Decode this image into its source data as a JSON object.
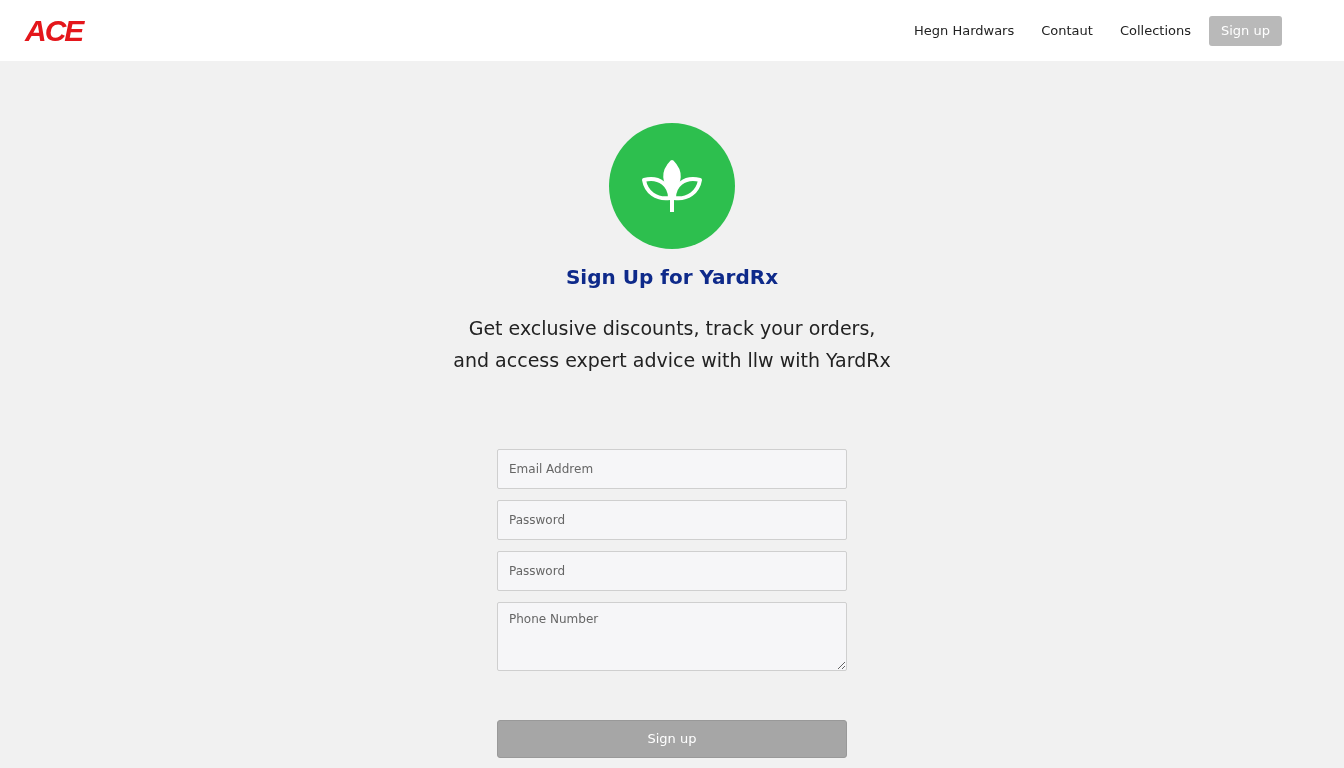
{
  "header": {
    "logo": "ACE",
    "nav": [
      {
        "label": "Hegn Hardwars",
        "kind": "link"
      },
      {
        "label": "Contaut",
        "kind": "link"
      },
      {
        "label": "Collections",
        "kind": "link"
      },
      {
        "label": "Sign up",
        "kind": "button"
      }
    ]
  },
  "hero": {
    "title": "Sign Up for YardRx",
    "lines": [
      "Get exclusive discounts, track your orders,",
      "and access expert advice with llw with YardRx"
    ]
  },
  "form": {
    "fields": [
      {
        "placeholder": "Email Addrem",
        "kind": "input"
      },
      {
        "placeholder": "Password",
        "kind": "input"
      },
      {
        "placeholder": "Password",
        "kind": "input"
      },
      {
        "placeholder": "Phone Number",
        "kind": "textarea"
      }
    ],
    "submit": "Sign up"
  }
}
